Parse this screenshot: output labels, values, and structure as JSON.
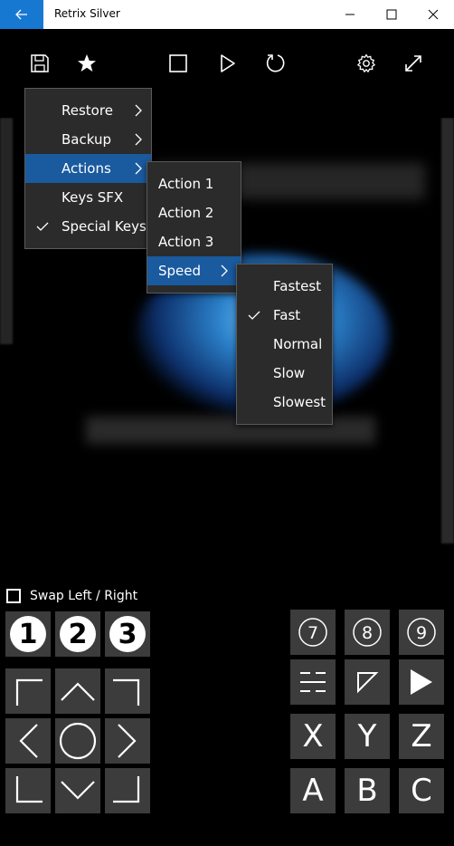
{
  "window": {
    "title": "Retrix Silver"
  },
  "toolbar": {
    "icons": [
      "save-icon",
      "star-icon",
      "stop-icon",
      "play-icon",
      "reset-icon",
      "settings-icon",
      "fullscreen-icon"
    ]
  },
  "menu_main": {
    "items": [
      {
        "label": "Restore",
        "submenu": true,
        "checked": false
      },
      {
        "label": "Backup",
        "submenu": true,
        "checked": false
      },
      {
        "label": "Actions",
        "submenu": true,
        "checked": false
      },
      {
        "label": "Keys SFX",
        "submenu": false,
        "checked": false
      },
      {
        "label": "Special Keys",
        "submenu": false,
        "checked": true
      }
    ],
    "active_index": 2
  },
  "menu_actions": {
    "items": [
      {
        "label": "Action 1"
      },
      {
        "label": "Action 2"
      },
      {
        "label": "Action 3"
      },
      {
        "label": "Speed",
        "submenu": true
      }
    ],
    "active_index": 3
  },
  "menu_speed": {
    "items": [
      {
        "label": "Fastest"
      },
      {
        "label": "Fast",
        "checked": true
      },
      {
        "label": "Normal"
      },
      {
        "label": "Slow"
      },
      {
        "label": "Slowest"
      }
    ]
  },
  "swap": {
    "label": "Swap Left / Right",
    "checked": false
  },
  "pads": {
    "numbers": [
      "1",
      "2",
      "3"
    ],
    "numbers_right": [
      "7",
      "8",
      "9"
    ],
    "letters_top": [
      "X",
      "Y",
      "Z"
    ],
    "letters_bottom": [
      "A",
      "B",
      "C"
    ]
  },
  "colors": {
    "accent": "#1778d2",
    "menu_active": "#1a5a9e",
    "pad_bg": "#3c3c3c",
    "menu_bg": "#2b2b2b"
  }
}
